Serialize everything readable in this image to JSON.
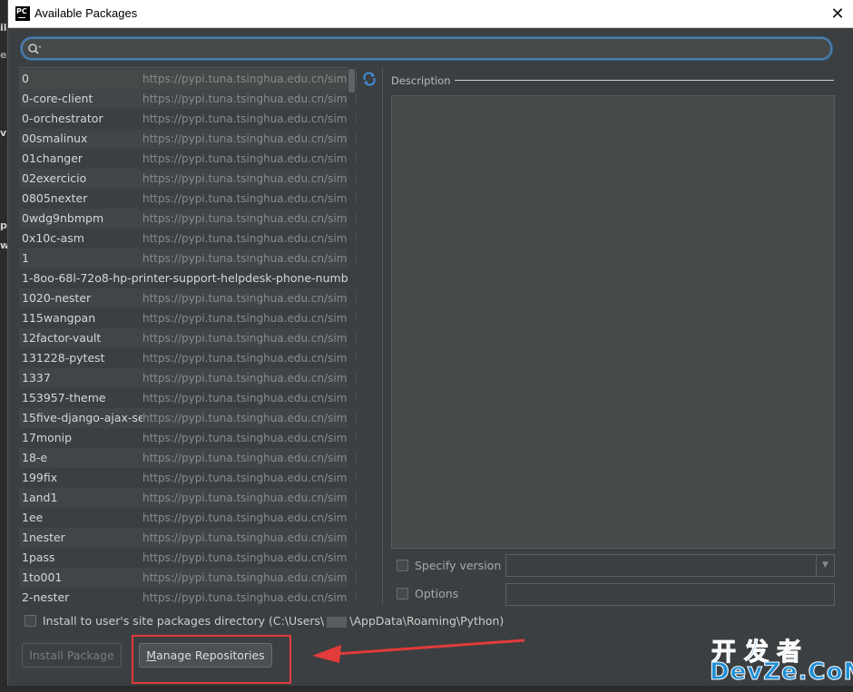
{
  "window": {
    "title": "Available Packages",
    "close_glyph": "✕"
  },
  "search": {
    "value": ""
  },
  "packages": [
    {
      "name": "0",
      "repo": "https://pypi.tuna.tsinghua.edu.cn/simple/"
    },
    {
      "name": "0-core-client",
      "repo": "https://pypi.tuna.tsinghua.edu.cn/simple/"
    },
    {
      "name": "0-orchestrator",
      "repo": "https://pypi.tuna.tsinghua.edu.cn/simple/"
    },
    {
      "name": "00smalinux",
      "repo": "https://pypi.tuna.tsinghua.edu.cn/simple/"
    },
    {
      "name": "01changer",
      "repo": "https://pypi.tuna.tsinghua.edu.cn/simple/"
    },
    {
      "name": "02exercicio",
      "repo": "https://pypi.tuna.tsinghua.edu.cn/simple/"
    },
    {
      "name": "0805nexter",
      "repo": "https://pypi.tuna.tsinghua.edu.cn/simple/"
    },
    {
      "name": "0wdg9nbmpm",
      "repo": "https://pypi.tuna.tsinghua.edu.cn/simple/"
    },
    {
      "name": "0x10c-asm",
      "repo": "https://pypi.tuna.tsinghua.edu.cn/simple/"
    },
    {
      "name": "1",
      "repo": "https://pypi.tuna.tsinghua.edu.cn/simple/"
    },
    {
      "name": "1-8oo-68l-72o8-hp-printer-support-helpdesk-phone-numbe",
      "repo": ""
    },
    {
      "name": "1020-nester",
      "repo": "https://pypi.tuna.tsinghua.edu.cn/simple/"
    },
    {
      "name": "115wangpan",
      "repo": "https://pypi.tuna.tsinghua.edu.cn/simple/"
    },
    {
      "name": "12factor-vault",
      "repo": "https://pypi.tuna.tsinghua.edu.cn/simple/"
    },
    {
      "name": "131228-pytest",
      "repo": "https://pypi.tuna.tsinghua.edu.cn/simple/"
    },
    {
      "name": "1337",
      "repo": "https://pypi.tuna.tsinghua.edu.cn/simple/"
    },
    {
      "name": "153957-theme",
      "repo": "https://pypi.tuna.tsinghua.edu.cn/simple/"
    },
    {
      "name": "15five-django-ajax-selects",
      "repo": "https://pypi.tuna.tsinghua.edu.cn/simple/"
    },
    {
      "name": "17monip",
      "repo": "https://pypi.tuna.tsinghua.edu.cn/simple/"
    },
    {
      "name": "18-e",
      "repo": "https://pypi.tuna.tsinghua.edu.cn/simple/"
    },
    {
      "name": "199fix",
      "repo": "https://pypi.tuna.tsinghua.edu.cn/simple/"
    },
    {
      "name": "1and1",
      "repo": "https://pypi.tuna.tsinghua.edu.cn/simple/"
    },
    {
      "name": "1ee",
      "repo": "https://pypi.tuna.tsinghua.edu.cn/simple/"
    },
    {
      "name": "1nester",
      "repo": "https://pypi.tuna.tsinghua.edu.cn/simple/"
    },
    {
      "name": "1pass",
      "repo": "https://pypi.tuna.tsinghua.edu.cn/simple/"
    },
    {
      "name": "1to001",
      "repo": "https://pypi.tuna.tsinghua.edu.cn/simple/"
    },
    {
      "name": "2-nester",
      "repo": "https://pypi.tuna.tsinghua.edu.cn/simple/"
    }
  ],
  "description": {
    "label": "Description",
    "text": ""
  },
  "specify_version": {
    "label": "Specify version",
    "checked": false,
    "value": ""
  },
  "options": {
    "label": "Options",
    "checked": false,
    "value": ""
  },
  "install_site": {
    "label_before": "Install to user's site packages directory (C:\\Users\\",
    "label_after": "\\AppData\\Roaming\\Python)",
    "checked": false
  },
  "buttons": {
    "install": "Install Package",
    "manage_first": "M",
    "manage_rest": "anage Repositories"
  },
  "watermark": {
    "top": "开发者",
    "bottom": "DevZe.CoM"
  },
  "background_window": {
    "fragments": [
      "il",
      "e",
      "vi",
      "p",
      "w"
    ]
  },
  "colors": {
    "dialog_bg": "#3c3f41",
    "search_focus": "#4c7ca8",
    "annotation_red": "#e23b3b",
    "watermark_blue": "#1f8fd6"
  }
}
